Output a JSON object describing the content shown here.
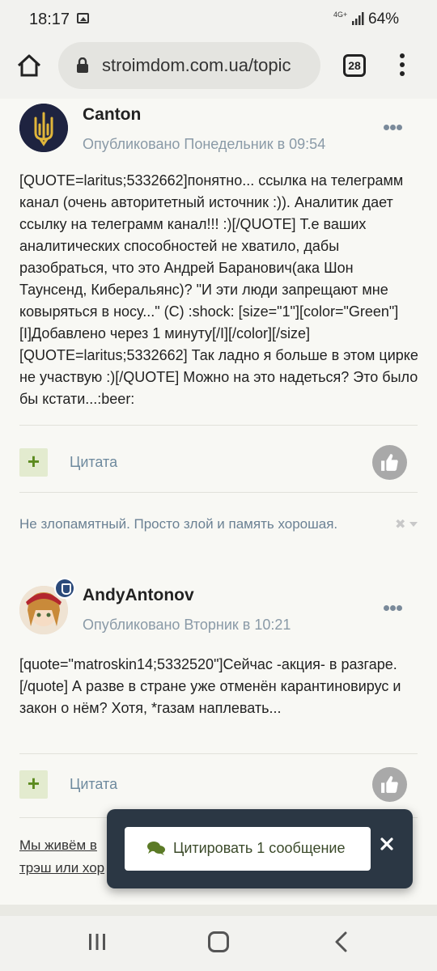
{
  "status_bar": {
    "time": "18:17",
    "network": "4G+",
    "battery": "64%"
  },
  "browser": {
    "url": "stroimdom.com.ua/topic",
    "tab_count": "28"
  },
  "posts": [
    {
      "author": "Canton",
      "published": "Опубликовано Понедельник в 09:54",
      "body": "[QUOTE=laritus;5332662]понятно... ссылка на телеграмм канал (очень авторитетный источник :)). Аналитик дает ссылку на телеграмм канал!!! :)[/QUOTE] Т.е ваших аналитических способностей не хватило, дабы разобраться, что это Андрей Баранович(ака Шон Таунсенд, Кибеpальянс)? \"И эти люди запрещают мне ковыряться в носу...\" (С) :shock: [size=\"1\"][color=\"Green\"][I]Добавлено через 1 минуту[/I][/color][/size] [QUOTE=laritus;5332662] Так ладно я больше в этом цирке не участвую :)[/QUOTE] Можно на это надеться? Это было бы кстати...:beer:",
      "plus": "+",
      "quote_label": "Цитата",
      "signature": "Не злопамятный. Просто злой и память хорошая."
    },
    {
      "author": "AndyAntonov",
      "published": "Опубликовано Вторник в 10:21",
      "body": "[quote=\"matroskin14;5332520\"]Сейчас -акция- в разгаре.[/quote] А разве в стране уже отменён карантиновирус и закон о нём? Хотя, *газам наплевать...",
      "plus": "+",
      "quote_label": "Цитата",
      "signature_line1": "Мы живём в",
      "signature_line2": "трэш или хор"
    }
  ],
  "popup": {
    "button_label": "Цитировать 1 сообщение"
  }
}
